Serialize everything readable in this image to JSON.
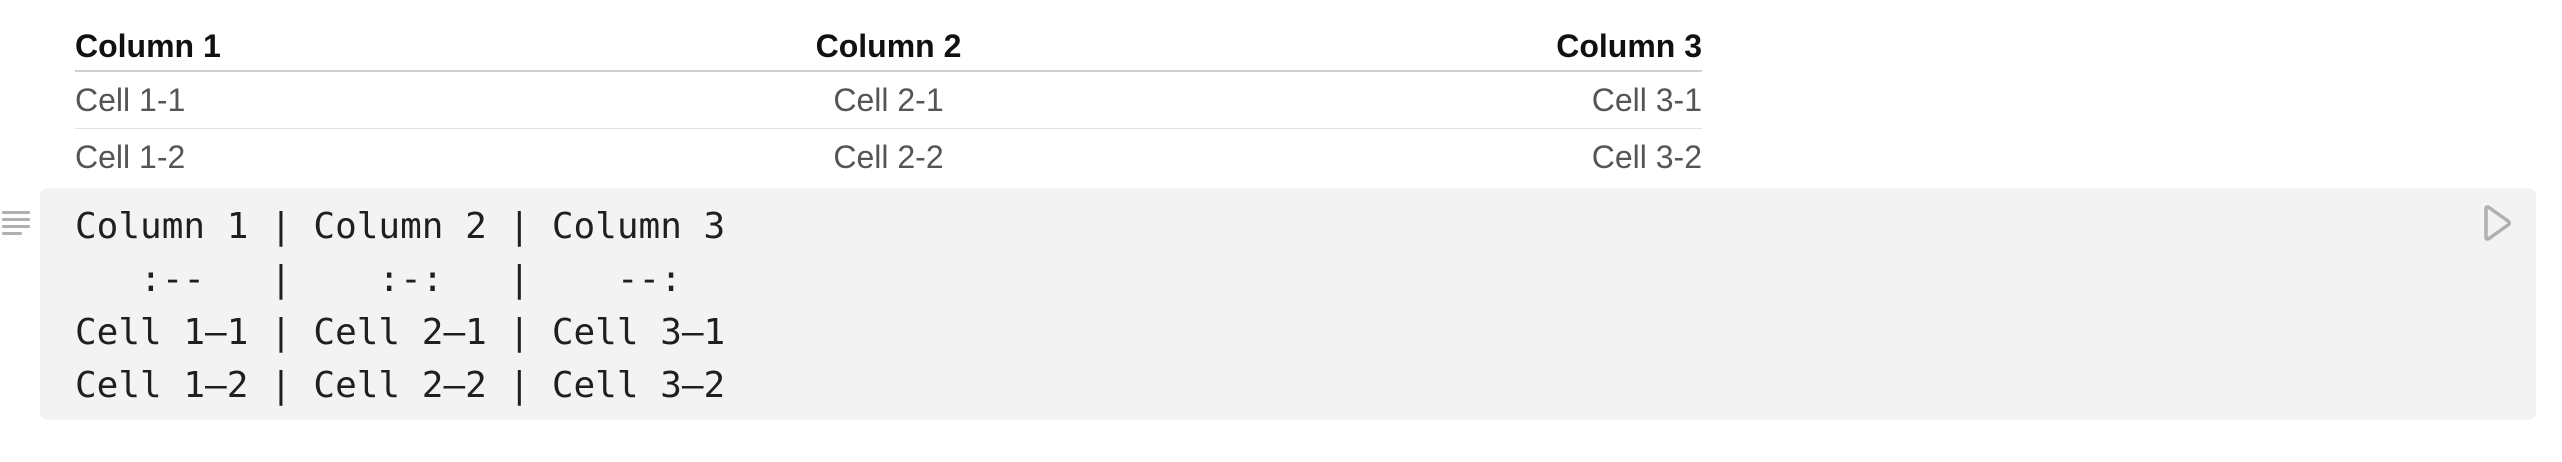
{
  "table": {
    "headers": [
      "Column 1",
      "Column 2",
      "Column 3"
    ],
    "rows": [
      [
        "Cell 1-1",
        "Cell 2-1",
        "Cell 3-1"
      ],
      [
        "Cell 1-2",
        "Cell 2-2",
        "Cell 3-2"
      ]
    ]
  },
  "code_cell": {
    "lines": [
      "Column 1 | Column 2 | Column 3",
      "   :--   |    :-:   |    --:",
      "Cell 1–1 | Cell 2–1 | Cell 3–1",
      "Cell 1–2 | Cell 2–2 | Cell 3–2"
    ],
    "run_icon": "run-icon",
    "drag_icon": "drag-handle-icon"
  },
  "colors": {
    "code_background": "#f3f3f3",
    "header_text": "#111111",
    "cell_text": "#555555",
    "header_rule": "#cfcfcf",
    "row_rule": "#e3e3e3",
    "icon": "#b0b0b0"
  }
}
